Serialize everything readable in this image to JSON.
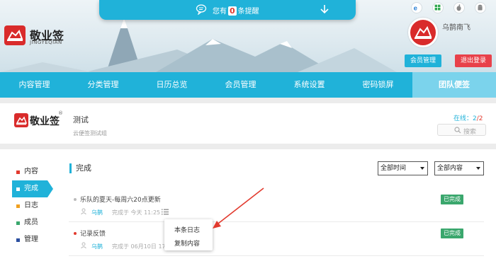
{
  "notice": {
    "prefix": "您有",
    "count": "0",
    "suffix": "条提醒"
  },
  "brand": {
    "name": "敬业签",
    "sub": "JINGYEQIAN"
  },
  "user": {
    "name": "乌鹊南飞",
    "member_btn": "会员管理",
    "logout_btn": "退出登录"
  },
  "platforms": [
    "ie-icon",
    "windows-icon",
    "apple-icon",
    "android-icon"
  ],
  "nav": [
    {
      "label": "内容管理"
    },
    {
      "label": "分类管理"
    },
    {
      "label": "日历总览"
    },
    {
      "label": "会员管理"
    },
    {
      "label": "系统设置"
    },
    {
      "label": "密码锁屏"
    },
    {
      "label": "团队便签"
    }
  ],
  "team": {
    "logo_name": "敬业签",
    "reg": "®",
    "title": "测试",
    "desc": "云便签测试组",
    "online_label": "在线：",
    "online_count": "2",
    "online_total": "/2",
    "search_placeholder": "搜索"
  },
  "side": [
    {
      "label": "内容",
      "color": "#e23a2e"
    },
    {
      "label": "完成",
      "color": "#ffffff"
    },
    {
      "label": "日志",
      "color": "#f0a020"
    },
    {
      "label": "成员",
      "color": "#3aa76d"
    },
    {
      "label": "管理",
      "color": "#2b4fa0"
    }
  ],
  "section": {
    "title": "完成",
    "filter_time": "全部时间",
    "filter_content": "全部内容"
  },
  "rows": [
    {
      "title": "乐队的夏天-每周六20点更新",
      "user": "乌鹊",
      "time": "完成于 今天 11:25",
      "status": "已完成",
      "dot": "#bbbbbb"
    },
    {
      "title": "记录反馈",
      "user": "乌鹊",
      "time": "完成于 06月10日 17",
      "status": "已完成",
      "dot": "#e23a2e"
    }
  ],
  "popup": {
    "item1": "本条日志",
    "item2": "复制内容"
  },
  "colors": {
    "accent": "#20b2d9",
    "danger": "#e8414a",
    "done": "#3aa76d"
  }
}
